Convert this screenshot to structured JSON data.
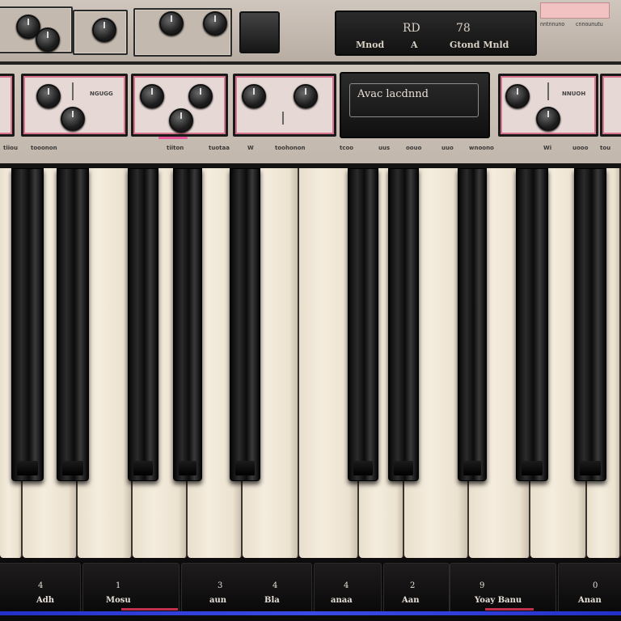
{
  "top_display": {
    "seg_left": "Mnod",
    "seg_rd": "RD",
    "seg_78": "78",
    "seg_a": "A",
    "seg_right": "Gtond Mnld"
  },
  "top_labels": [
    "nntnnuno",
    "cnnounutu"
  ],
  "center_display": {
    "text": "Avac  lacdnnd"
  },
  "module_labels": {
    "left": "NGUGG",
    "middle_right": "NNUOH"
  },
  "strip_labels": [
    "tiiou",
    "tooonon",
    "tiiton",
    "tuotaa",
    "W",
    "toohonon",
    "tcoo",
    "uus",
    "oouo",
    "uuo",
    "wnoono",
    "Wi",
    "uooo",
    "tou"
  ],
  "pads": [
    {
      "num": "4",
      "label": "Adh"
    },
    {
      "num": "1",
      "label": "Mosu"
    },
    {
      "num": "3",
      "label": "aun"
    },
    {
      "num": "4",
      "label": "Bla"
    },
    {
      "num": "4",
      "label": "anaa"
    },
    {
      "num": "2",
      "label": "Aan"
    },
    {
      "num": "9",
      "label": "Yoay  Banu"
    },
    {
      "num": "0",
      "label": "Anan"
    }
  ],
  "colors": {
    "panel": "#c4b9ae",
    "accent_pink": "#d8748d",
    "led_pink": "#e8579a",
    "key_ivory": "#f1e8d8",
    "strip_blue": "#2f40d8"
  }
}
